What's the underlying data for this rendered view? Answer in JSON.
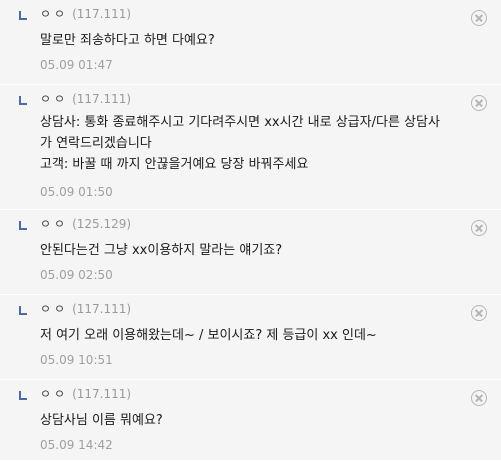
{
  "comments": [
    {
      "author": "ㅇㅇ",
      "ip": "(117.111)",
      "lines": [
        "말로만 죄송하다고 하면 다예요?"
      ],
      "date": "05.09 01:47"
    },
    {
      "author": "ㅇㅇ",
      "ip": "(117.111)",
      "lines": [
        "상담사: 통화 종료해주시고 기다려주시면 xx시간 내로 상급자/다른 상담사",
        "가 연락드리겠습니다",
        "고객: 바꿀 때 까지 안끊을거예요 당장 바꿔주세요"
      ],
      "date": "05.09 01:50"
    },
    {
      "author": "ㅇㅇ",
      "ip": "(125.129)",
      "lines": [
        "안된다는건 그냥 xx이용하지 말라는 얘기죠?"
      ],
      "date": "05.09 02:50"
    },
    {
      "author": "ㅇㅇ",
      "ip": "(117.111)",
      "lines": [
        "저 여기 오래 이용해왔는데~ / 보이시죠? 제 등급이 xx 인데~"
      ],
      "date": "05.09 10:51"
    },
    {
      "author": "ㅇㅇ",
      "ip": "(117.111)",
      "lines": [
        "상담사님 이름 뭐예요?"
      ],
      "date": "05.09 14:42"
    }
  ]
}
